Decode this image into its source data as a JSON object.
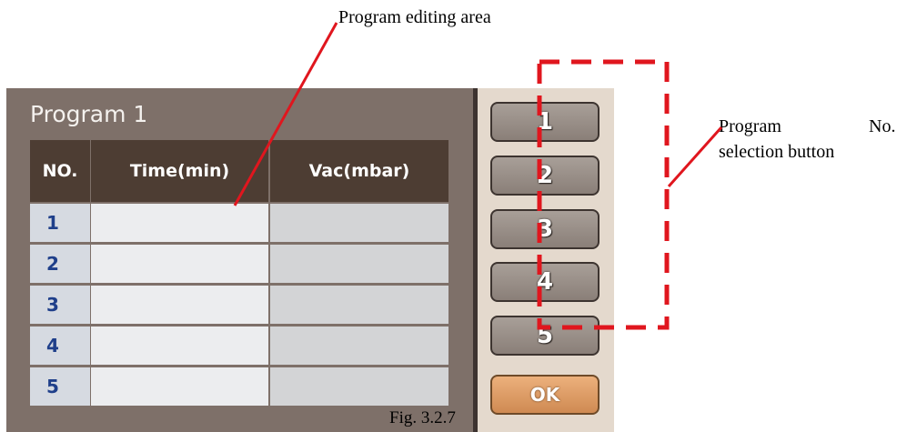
{
  "panel": {
    "title": "Program 1",
    "columns": [
      "NO.",
      "Time(min)",
      "Vac(mbar)"
    ],
    "rows": [
      {
        "no": "1",
        "time": "",
        "vac": ""
      },
      {
        "no": "2",
        "time": "",
        "vac": ""
      },
      {
        "no": "3",
        "time": "",
        "vac": ""
      },
      {
        "no": "4",
        "time": "",
        "vac": ""
      },
      {
        "no": "5",
        "time": "",
        "vac": ""
      }
    ]
  },
  "program_buttons": [
    "1",
    "2",
    "3",
    "4",
    "5"
  ],
  "ok_label": "OK",
  "annotations": {
    "editing_area": "Program editing area",
    "selection_line1_a": "Program",
    "selection_line1_b": "No.",
    "selection_line2": "selection button"
  },
  "caption": "Fig. 3.2.7",
  "colors": {
    "panel_bg": "#7e7069",
    "header_bg": "#4d3d33",
    "button_area_bg": "#e4d9cd",
    "ok_button": "#dd9a62",
    "annotation_red": "#e0161e"
  }
}
